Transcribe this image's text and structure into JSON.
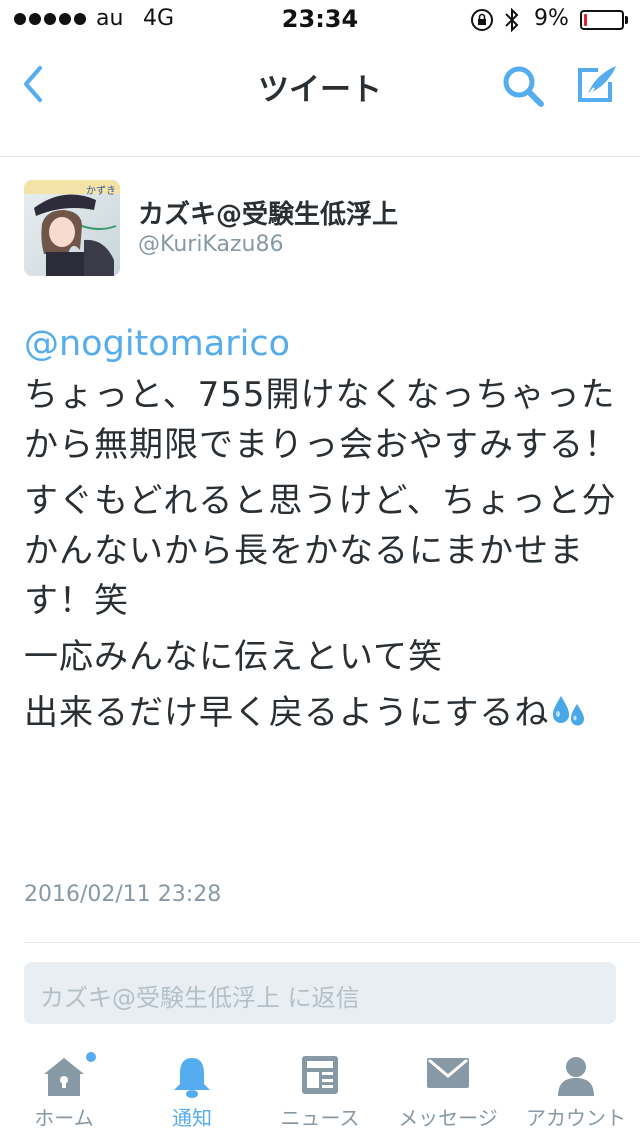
{
  "status_bar": {
    "carrier": "au",
    "network": "4G",
    "time": "23:34",
    "battery_percent": "9%",
    "battery_level": 0.09
  },
  "nav": {
    "title": "ツイート",
    "back_icon": "chevron-left-icon",
    "search_icon": "search-icon",
    "compose_icon": "compose-tweet-icon"
  },
  "tweet": {
    "author_name": "カズキ@受験生低浮上",
    "author_handle": "@KuriKazu86",
    "mention": "@nogitomarico",
    "paragraphs": [
      "ちょっと、755開けなくなっちゃったから無期限でまりっ会おやすみする！",
      "すぐもどれると思うけど、ちょっと分かんないから長をかなるにまかせます！笑",
      "一応みんなに伝えといて笑",
      "出来るだけ早く戻るようにするね"
    ],
    "trailing_emoji": "sweat-drops-emoji",
    "timestamp": "2016/02/11 23:28"
  },
  "reply": {
    "placeholder": "カズキ@受験生低浮上 に返信"
  },
  "tabs": [
    {
      "label": "ホーム",
      "icon": "home-icon",
      "active": false,
      "badge": true
    },
    {
      "label": "通知",
      "icon": "bell-icon",
      "active": true,
      "badge": false
    },
    {
      "label": "ニュース",
      "icon": "news-icon",
      "active": false,
      "badge": false
    },
    {
      "label": "メッセージ",
      "icon": "envelope-icon",
      "active": false,
      "badge": false
    },
    {
      "label": "アカウント",
      "icon": "person-icon",
      "active": false,
      "badge": false
    }
  ],
  "colors": {
    "accent": "#55acee",
    "text": "#292f33",
    "secondary": "#8899a6",
    "battery_low": "#e0242a"
  }
}
